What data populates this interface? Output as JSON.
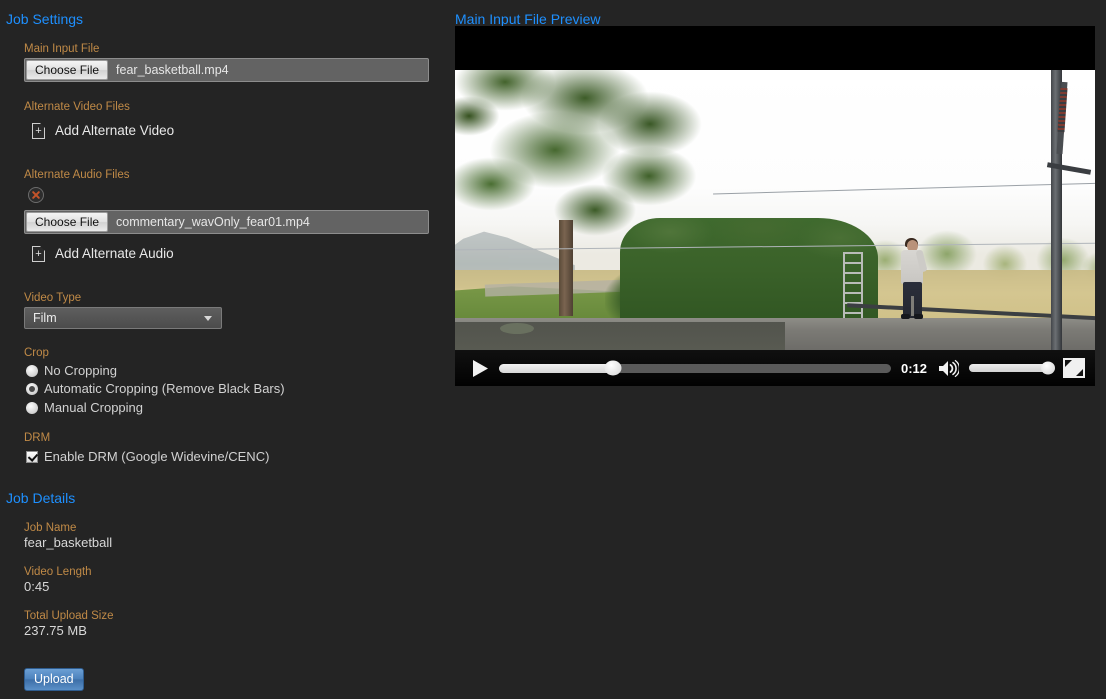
{
  "job_settings": {
    "title": "Job Settings",
    "main_input_file": {
      "label": "Main Input File",
      "button_label": "Choose File",
      "value": "fear_basketball.mp4"
    },
    "alternate_video": {
      "label": "Alternate Video Files",
      "add_label": "Add Alternate Video",
      "add_icon": "document-plus-icon"
    },
    "alternate_audio": {
      "label": "Alternate Audio Files",
      "remove_icon": "remove-circle-x-icon",
      "button_label": "Choose File",
      "value": "commentary_wavOnly_fear01.mp4",
      "add_label": "Add Alternate Audio",
      "add_icon": "document-plus-icon"
    },
    "video_type": {
      "label": "Video Type",
      "selected": "Film",
      "options": [
        "Film"
      ],
      "arrow_icon": "chevron-down-icon"
    },
    "crop": {
      "label": "Crop",
      "options": [
        {
          "label": "No Cropping",
          "checked": false
        },
        {
          "label": "Automatic Cropping (Remove Black Bars)",
          "checked": true
        },
        {
          "label": "Manual Cropping",
          "checked": false
        }
      ]
    },
    "drm": {
      "label": "DRM",
      "option_label": "Enable DRM (Google Widevine/CENC)",
      "checked": true
    }
  },
  "job_details": {
    "title": "Job Details",
    "fields": [
      {
        "label": "Job Name",
        "value": "fear_basketball"
      },
      {
        "label": "Video Length",
        "value": "0:45"
      },
      {
        "label": "Total Upload Size",
        "value": "237.75 MB"
      }
    ],
    "upload_label": "Upload"
  },
  "preview": {
    "title": "Main Input File Preview",
    "player": {
      "play_icon": "play-icon",
      "time": "0:12",
      "volume_icon": "speaker-on-icon",
      "fullscreen_icon": "fullscreen-icon",
      "progress_percent": 29,
      "volume_percent": 92
    }
  },
  "colors": {
    "background": "#242424",
    "section_title": "#1e90ff",
    "field_label": "#c08a47",
    "value_text": "#d8d8d8",
    "upload_button": "#4d83bd"
  }
}
